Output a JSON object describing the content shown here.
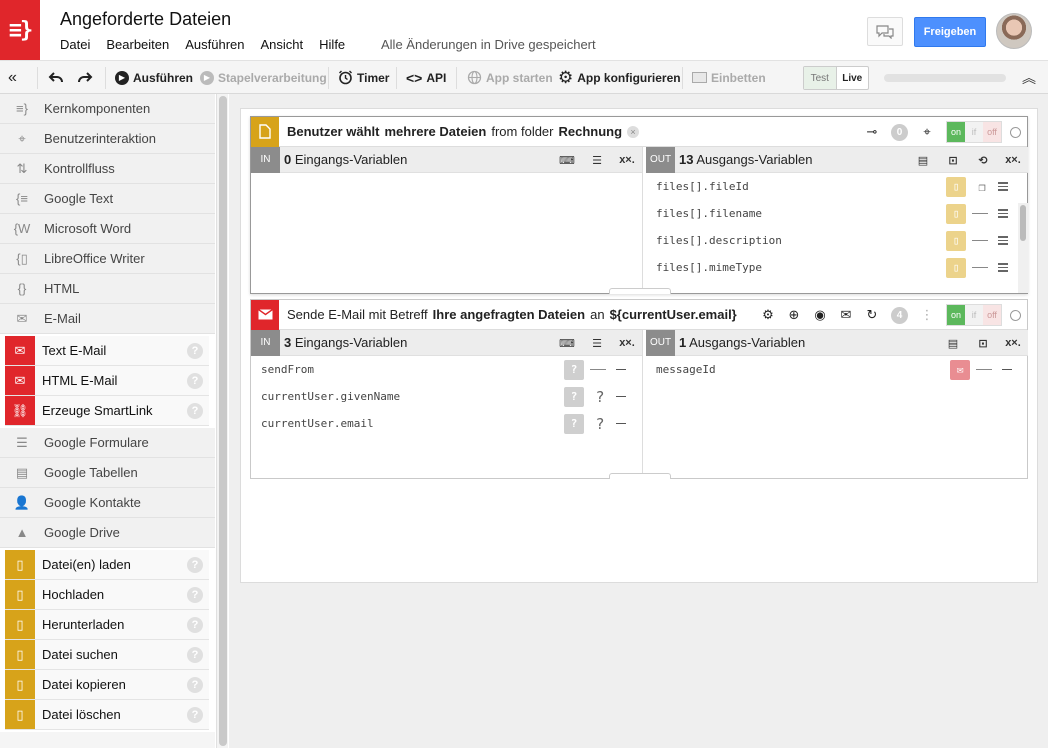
{
  "app": {
    "title": "Angeforderte Dateien",
    "menu": [
      "Datei",
      "Bearbeiten",
      "Ausführen",
      "Ansicht",
      "Hilfe"
    ],
    "save_status": "Alle Änderungen in Drive gespeichert",
    "share_label": "Freigeben",
    "brand_color": "#e0262b",
    "share_color": "#4d90fe"
  },
  "toolbar": {
    "run": "Ausführen",
    "batch": "Stapelverarbeitung",
    "timer": "Timer",
    "api": "API",
    "start_app": "App starten",
    "configure_app": "App konfigurieren",
    "embed": "Einbetten",
    "env_test": "Test",
    "env_live": "Live"
  },
  "sidebar": {
    "categories_top": [
      {
        "label": "Kernkomponenten",
        "icon": "code-brace-icon"
      },
      {
        "label": "Benutzerinteraktion",
        "icon": "user-interaction-icon"
      },
      {
        "label": "Kontrollfluss",
        "icon": "control-flow-icon"
      },
      {
        "label": "Google Text",
        "icon": "google-text-icon"
      },
      {
        "label": "Microsoft Word",
        "icon": "word-icon"
      },
      {
        "label": "LibreOffice Writer",
        "icon": "writer-icon"
      },
      {
        "label": "HTML",
        "icon": "html-icon"
      },
      {
        "label": "E-Mail",
        "icon": "mail-icon"
      }
    ],
    "email_items": [
      {
        "label": "Text E-Mail"
      },
      {
        "label": "HTML E-Mail"
      },
      {
        "label": "Erzeuge SmartLink"
      }
    ],
    "categories_mid": [
      {
        "label": "Google Formulare",
        "icon": "forms-icon"
      },
      {
        "label": "Google Tabellen",
        "icon": "sheets-icon"
      },
      {
        "label": "Google Kontakte",
        "icon": "contacts-icon"
      },
      {
        "label": "Google Drive",
        "icon": "drive-icon"
      }
    ],
    "drive_items": [
      {
        "label": "Datei(en) laden"
      },
      {
        "label": "Hochladen"
      },
      {
        "label": "Herunterladen"
      },
      {
        "label": "Datei suchen"
      },
      {
        "label": "Datei kopieren"
      },
      {
        "label": "Datei löschen"
      }
    ],
    "help_glyph": "?"
  },
  "steps": [
    {
      "title_parts": [
        "Benutzer wählt",
        "mehrere Dateien",
        "from folder",
        "Rechnung"
      ],
      "badge": "0",
      "toggle": {
        "on": "on",
        "if": "if",
        "off": "off"
      },
      "in": {
        "tag": "IN",
        "count": "0",
        "label": "Eingangs-Variablen",
        "rows": []
      },
      "out": {
        "tag": "OUT",
        "count": "13",
        "label": "Ausgangs-Variablen",
        "rows": [
          "files[].fileId",
          "files[].filename",
          "files[].description",
          "files[].mimeType"
        ]
      }
    },
    {
      "title_parts": [
        "Sende E-Mail mit Betreff",
        "Ihre angefragten Dateien",
        "an",
        "${currentUser.email}"
      ],
      "badge": "4",
      "toggle": {
        "on": "on",
        "if": "if",
        "off": "off"
      },
      "in": {
        "tag": "IN",
        "count": "3",
        "label": "Eingangs-Variablen",
        "rows": [
          "sendFrom",
          "currentUser.givenName",
          "currentUser.email"
        ]
      },
      "out": {
        "tag": "OUT",
        "count": "1",
        "label": "Ausgangs-Variablen",
        "rows": [
          "messageId"
        ]
      }
    }
  ],
  "xx_label": "x×."
}
